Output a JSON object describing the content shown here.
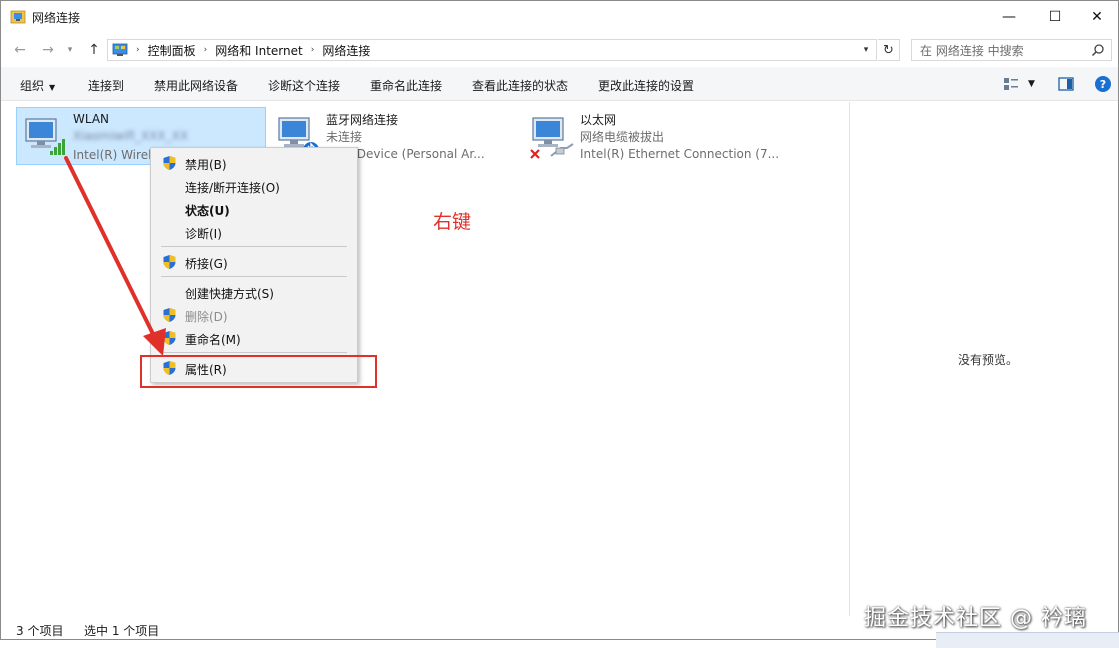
{
  "window": {
    "title": "网络连接",
    "minimize": "—",
    "maximize": "☐",
    "close": "✕"
  },
  "address": {
    "crumbs": [
      "控制面板",
      "网络和 Internet",
      "网络连接"
    ],
    "search_placeholder": "在 网络连接 中搜索"
  },
  "toolbar": {
    "organize": "组织",
    "items": [
      "连接到",
      "禁用此网络设备",
      "诊断这个连接",
      "重命名此连接",
      "查看此连接的状态",
      "更改此连接的设置"
    ],
    "help": "?"
  },
  "connections": [
    {
      "name": "WLAN",
      "status": "Xiaomiwifi_XXX_XX",
      "device": "Intel(R) Wirele",
      "selected": true
    },
    {
      "name": "蓝牙网络连接",
      "status": "未连接",
      "device": "ooth Device (Personal Ar...",
      "selected": false
    },
    {
      "name": "以太网",
      "status": "网络电缆被拔出",
      "device": "Intel(R) Ethernet Connection (7...",
      "selected": false
    }
  ],
  "context_menu": [
    {
      "label": "禁用(B)",
      "shield": true
    },
    {
      "label": "连接/断开连接(O)",
      "shield": false
    },
    {
      "label": "状态(U)",
      "shield": false,
      "bold": true
    },
    {
      "label": "诊断(I)",
      "shield": false
    },
    {
      "label": "桥接(G)",
      "shield": true
    },
    {
      "label": "创建快捷方式(S)",
      "shield": false
    },
    {
      "label": "删除(D)",
      "shield": true,
      "disabled": true
    },
    {
      "label": "重命名(M)",
      "shield": true
    },
    {
      "label": "属性(R)",
      "shield": true
    }
  ],
  "annotation": "右键",
  "preview": {
    "empty_text": "没有预览。"
  },
  "status": {
    "count": "3 个项目",
    "selected": "选中 1 个项目"
  },
  "watermark": "掘金技术社区 @ 衿璃",
  "colors": {
    "accent_red": "#e0302a",
    "selection": "#cce8ff",
    "help_blue": "#1b6fd1"
  }
}
